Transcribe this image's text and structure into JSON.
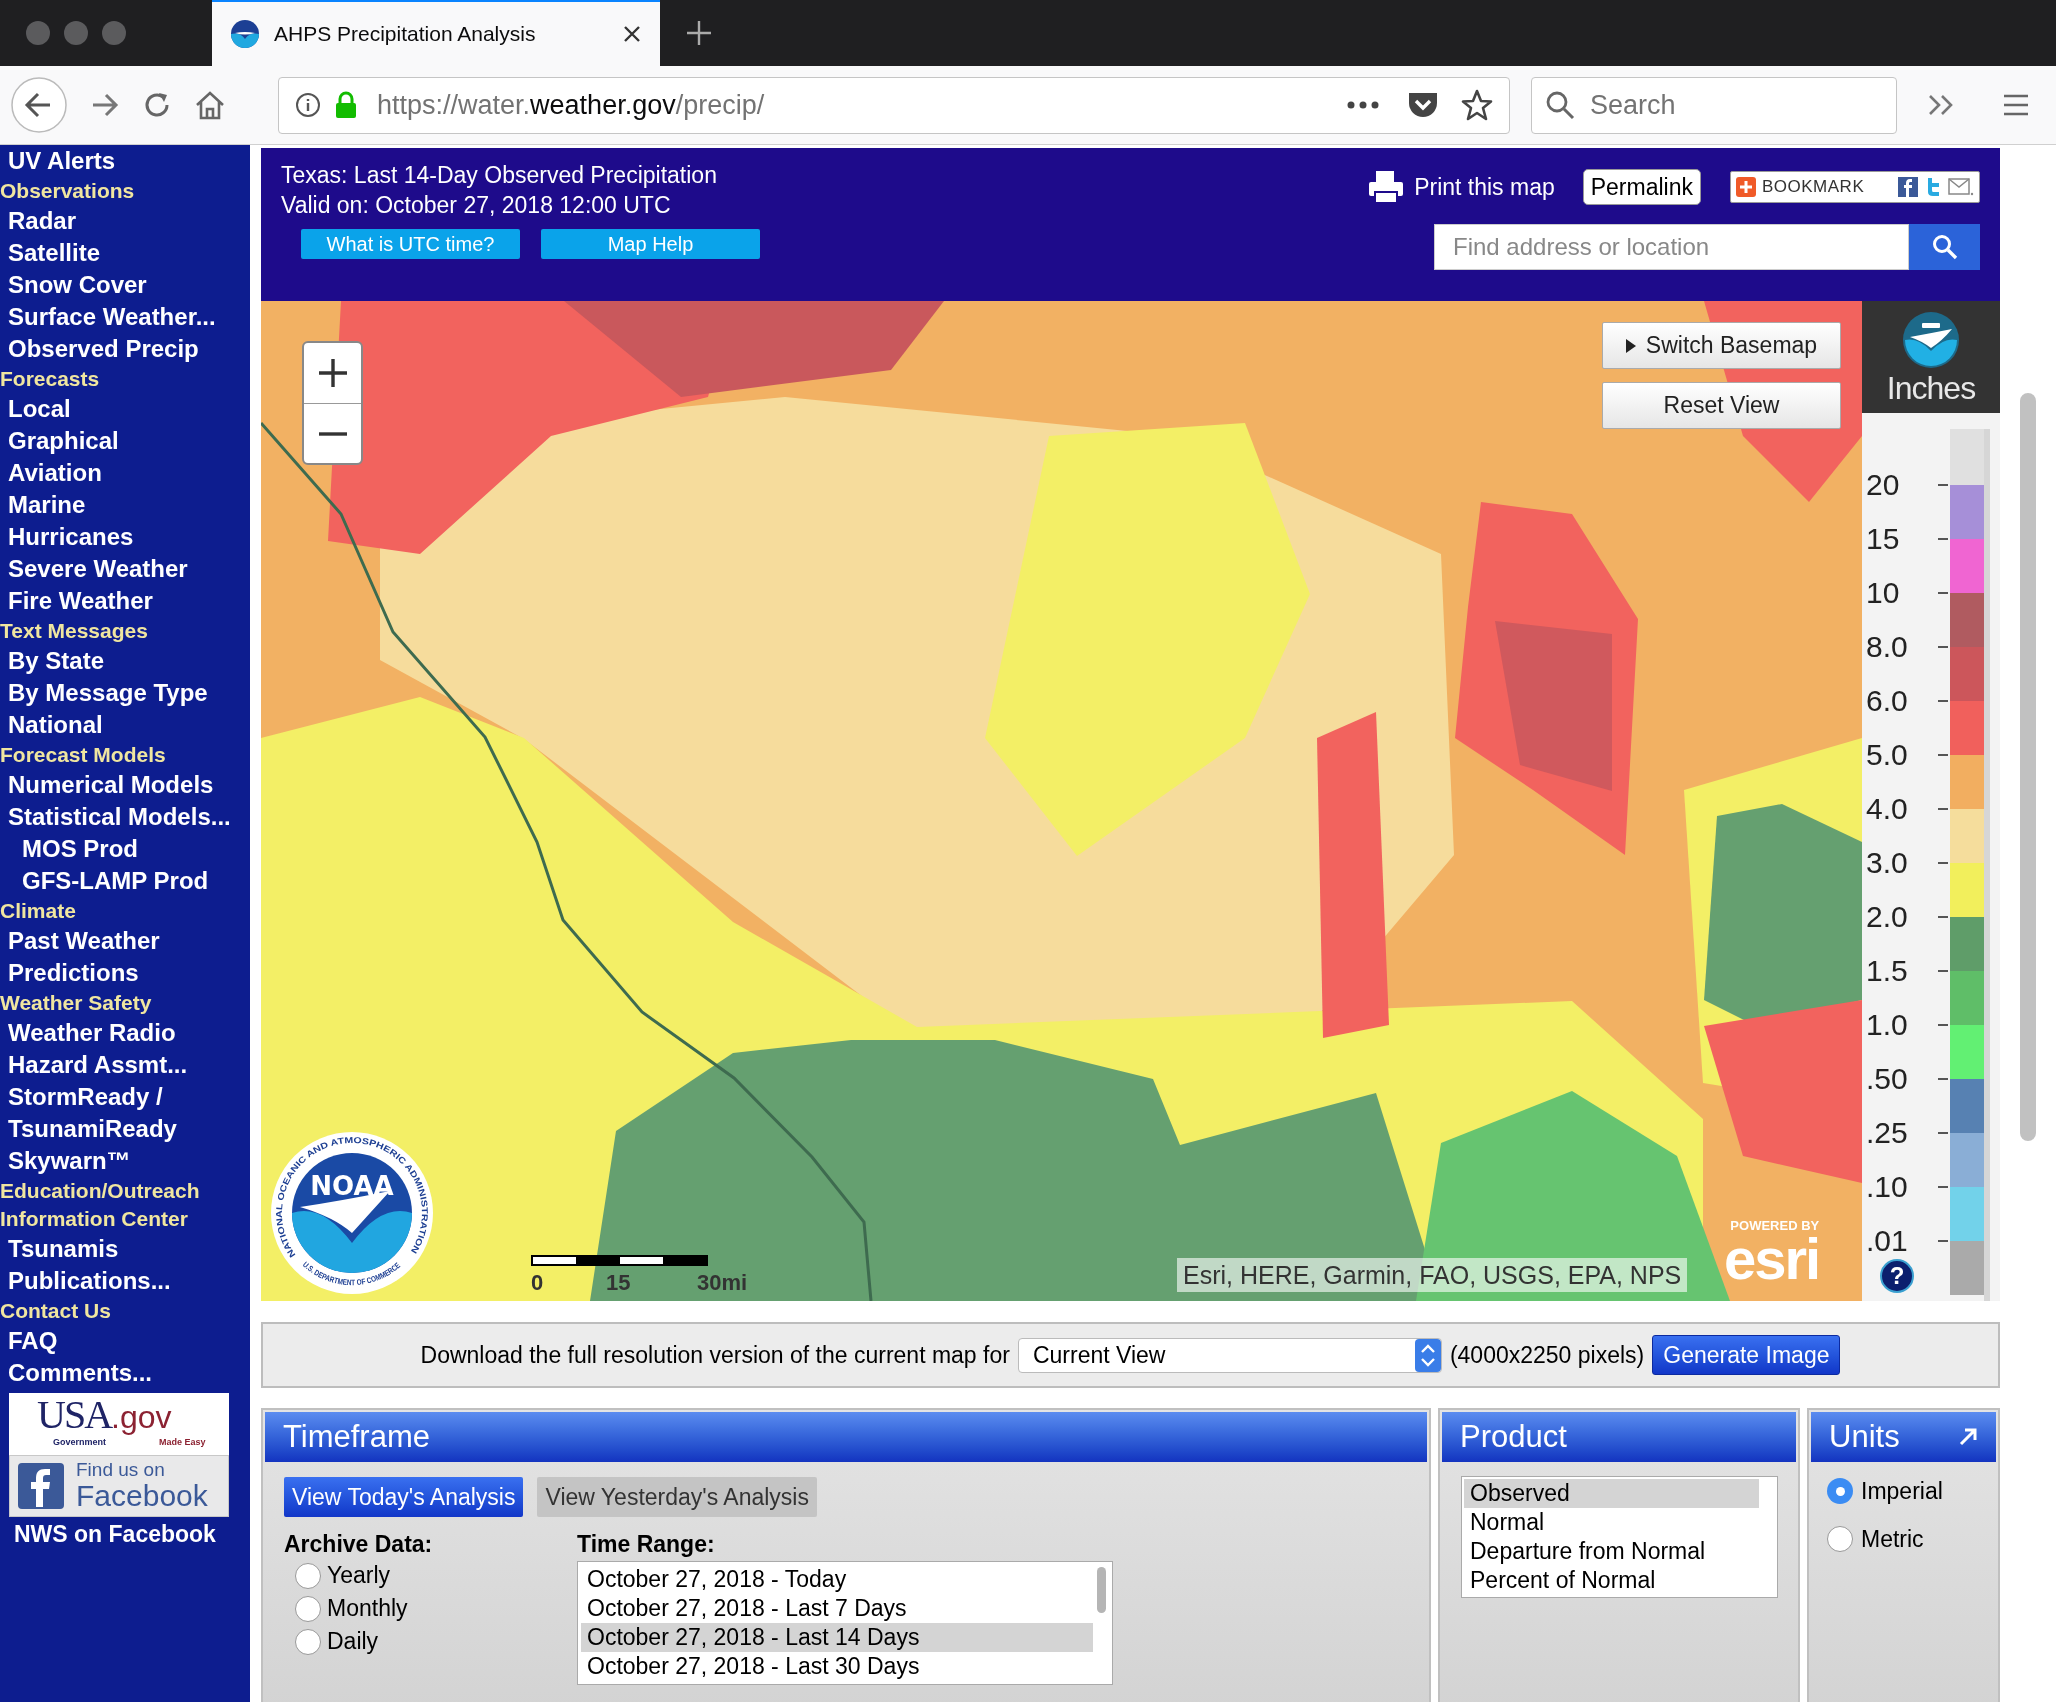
{
  "browser": {
    "tab_title": "AHPS Precipitation Analysis",
    "url": {
      "lead": "https://water.",
      "domain": "weather.gov",
      "path": "/precip/"
    },
    "search_placeholder": "Search"
  },
  "sidebar": {
    "items": [
      {
        "label": "UV Alerts",
        "kind": "link"
      },
      {
        "label": "Observations",
        "kind": "heading"
      },
      {
        "label": "Radar",
        "kind": "link"
      },
      {
        "label": "Satellite",
        "kind": "link"
      },
      {
        "label": "Snow Cover",
        "kind": "link"
      },
      {
        "label": "Surface Weather...",
        "kind": "link"
      },
      {
        "label": "Observed Precip",
        "kind": "link"
      },
      {
        "label": "Forecasts",
        "kind": "heading"
      },
      {
        "label": "Local",
        "kind": "link"
      },
      {
        "label": "Graphical",
        "kind": "link"
      },
      {
        "label": "Aviation",
        "kind": "link"
      },
      {
        "label": "Marine",
        "kind": "link"
      },
      {
        "label": "Hurricanes",
        "kind": "link"
      },
      {
        "label": "Severe Weather",
        "kind": "link"
      },
      {
        "label": "Fire Weather",
        "kind": "link"
      },
      {
        "label": "Text Messages",
        "kind": "heading"
      },
      {
        "label": "By State",
        "kind": "link"
      },
      {
        "label": "By Message Type",
        "kind": "link"
      },
      {
        "label": "National",
        "kind": "link"
      },
      {
        "label": "Forecast Models",
        "kind": "heading"
      },
      {
        "label": "Numerical Models",
        "kind": "link"
      },
      {
        "label": "Statistical Models...",
        "kind": "link"
      },
      {
        "label": "MOS Prod",
        "kind": "sublink"
      },
      {
        "label": "GFS-LAMP Prod",
        "kind": "sublink"
      },
      {
        "label": "Climate",
        "kind": "heading"
      },
      {
        "label": "Past Weather",
        "kind": "link"
      },
      {
        "label": "Predictions",
        "kind": "link"
      },
      {
        "label": "Weather Safety",
        "kind": "heading"
      },
      {
        "label": "Weather Radio",
        "kind": "link"
      },
      {
        "label": "Hazard Assmt...",
        "kind": "link"
      },
      {
        "label": "StormReady /",
        "kind": "link"
      },
      {
        "label": "TsunamiReady",
        "kind": "link"
      },
      {
        "label": "Skywarn™",
        "kind": "link"
      },
      {
        "label": "Education/Outreach",
        "kind": "heading"
      },
      {
        "label": "Information Center",
        "kind": "heading"
      },
      {
        "label": "Tsunamis",
        "kind": "link"
      },
      {
        "label": "Publications...",
        "kind": "link"
      },
      {
        "label": "Contact Us",
        "kind": "heading"
      },
      {
        "label": "FAQ",
        "kind": "link"
      },
      {
        "label": "Comments...",
        "kind": "link"
      }
    ],
    "usagov": {
      "word": "USA",
      "suffix": ".gov",
      "tag_left": "Government",
      "tag_right": "Made Easy"
    },
    "facebook": {
      "line1": "Find us on",
      "line2": "Facebook"
    },
    "footer_link": "NWS on Facebook"
  },
  "header": {
    "title": "Texas: Last 14-Day Observed Precipitation",
    "valid": "Valid on: October 27, 2018 12:00 UTC",
    "buttons": [
      "What is UTC time?",
      "Map Help"
    ],
    "print": "Print this map",
    "permalink": "Permalink",
    "bookmark": "BOOKMARK",
    "search_placeholder": "Find address or location"
  },
  "map": {
    "buttons": [
      "Switch Basemap",
      "Reset View"
    ],
    "attribution": "Esri, HERE, Garmin, FAO, USGS, EPA, NPS",
    "scale_labels": [
      "0",
      "15",
      "30mi"
    ],
    "esri": {
      "top": "POWERED BY",
      "word": "esri"
    },
    "noaa": {
      "acronym": "NOAA",
      "ring_top": "NATIONAL OCEANIC AND ATMOSPHERIC ADMINISTRATION",
      "ring_bottom": "U.S. DEPARTMENT OF COMMERCE"
    }
  },
  "legend": {
    "title": "Inches",
    "help": "?",
    "bands": [
      {
        "color": "#e0e0e0"
      }
    ],
    "steps": [
      {
        "label": "20",
        "color": "#a68fd8"
      },
      {
        "label": "15",
        "color": "#f065d2"
      },
      {
        "label": "10",
        "color": "#b05b60"
      },
      {
        "label": "8.0",
        "color": "#cc565b"
      },
      {
        "label": "6.0",
        "color": "#f1605c"
      },
      {
        "label": "5.0",
        "color": "#f2ae60"
      },
      {
        "label": "4.0",
        "color": "#f5dd9c"
      },
      {
        "label": "3.0",
        "color": "#f2ef5c"
      },
      {
        "label": "2.0",
        "color": "#5f9d69"
      },
      {
        "label": "1.5",
        "color": "#5fbe68"
      },
      {
        "label": "1.0",
        "color": "#62f073"
      },
      {
        "label": ".50",
        "color": "#5781b2"
      },
      {
        "label": ".25",
        "color": "#8aaed6"
      },
      {
        "label": ".10",
        "color": "#72d2ea"
      },
      {
        "label": ".01",
        "color": "#aaaaaa"
      }
    ]
  },
  "download": {
    "text": "Download the full resolution version of the current map for",
    "select_value": "Current View",
    "pixels": "(4000x2250 pixels)",
    "button": "Generate Image"
  },
  "timeframe": {
    "title": "Timeframe",
    "buttons": [
      {
        "label": "View Today's Analysis",
        "selected": true
      },
      {
        "label": "View Yesterday's Analysis",
        "selected": false
      }
    ],
    "archive": {
      "label": "Archive Data:",
      "options": [
        {
          "label": "Yearly",
          "selected": false
        },
        {
          "label": "Monthly",
          "selected": false
        },
        {
          "label": "Daily",
          "selected": false
        }
      ]
    },
    "time_range": {
      "label": "Time Range:",
      "options": [
        {
          "label": "October 27, 2018 - Today",
          "selected": false
        },
        {
          "label": "October 27, 2018 - Last 7 Days",
          "selected": false
        },
        {
          "label": "October 27, 2018 - Last 14 Days",
          "selected": true
        },
        {
          "label": "October 27, 2018 - Last 30 Days",
          "selected": false
        }
      ]
    }
  },
  "product": {
    "title": "Product",
    "options": [
      {
        "label": "Observed",
        "selected": true
      },
      {
        "label": "Normal",
        "selected": false
      },
      {
        "label": "Departure from Normal",
        "selected": false
      },
      {
        "label": "Percent of Normal",
        "selected": false
      }
    ]
  },
  "units": {
    "title": "Units",
    "options": [
      {
        "label": "Imperial",
        "selected": true
      },
      {
        "label": "Metric",
        "selected": false
      }
    ]
  }
}
